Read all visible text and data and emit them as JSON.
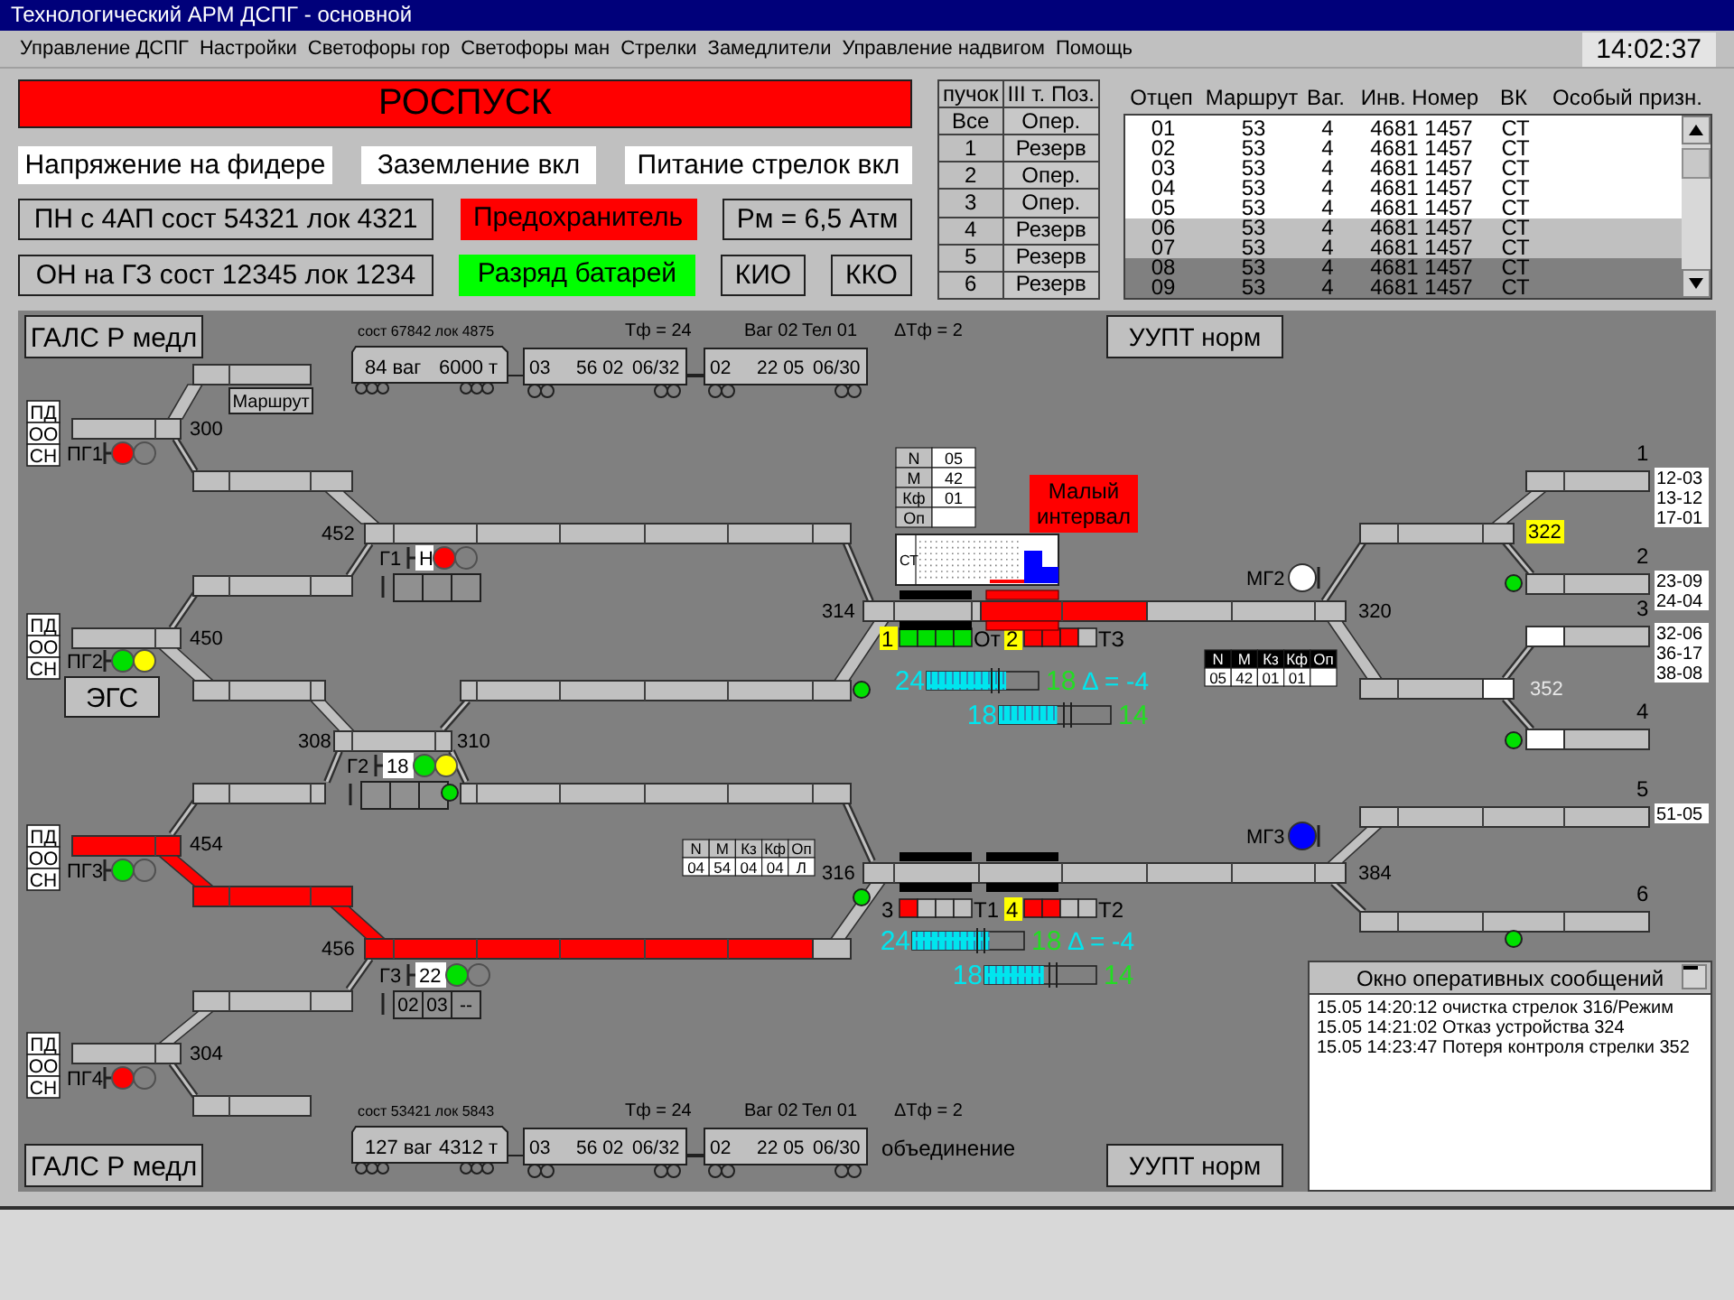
{
  "window": {
    "title": "Технологический АРМ ДСПГ - основной",
    "clock": "14:02:37"
  },
  "menu": [
    "Управление ДСПГ",
    "Настройки",
    "Светофоры гор",
    "Светофоры ман",
    "Стрелки",
    "Замедлители",
    "Управление надвигом",
    "Помощь"
  ],
  "mode_banner": {
    "text": "РОСПУСК",
    "alarm": true
  },
  "status_rows": [
    [
      {
        "text": "Напряжение на фидере",
        "kind": "info"
      },
      {
        "text": "Заземление вкл",
        "kind": "info"
      },
      {
        "text": "Питание стрелок вкл",
        "kind": "info"
      }
    ],
    [
      {
        "text": "ПН с 4АП сост 54321 лок 4321",
        "kind": "button"
      },
      {
        "text": "Предохранитель",
        "kind": "alarm"
      },
      {
        "text": "Рм = 6,5 Атм",
        "kind": "button"
      }
    ],
    [
      {
        "text": "ОН на ГЗ сост 12345 лок 1234",
        "kind": "button"
      },
      {
        "text": "Разряд батарей",
        "kind": "ok"
      },
      {
        "text": "КИО",
        "kind": "button"
      },
      {
        "text": "ККО",
        "kind": "button"
      }
    ]
  ],
  "bundles": {
    "columns": [
      "пучок",
      "III т. Поз."
    ],
    "rows": [
      {
        "bundle": "Все",
        "mode": "Опер."
      },
      {
        "bundle": "1",
        "mode": "Резерв"
      },
      {
        "bundle": "2",
        "mode": "Опер."
      },
      {
        "bundle": "3",
        "mode": "Опер."
      },
      {
        "bundle": "4",
        "mode": "Резерв"
      },
      {
        "bundle": "5",
        "mode": "Резерв"
      },
      {
        "bundle": "6",
        "mode": "Резерв"
      }
    ]
  },
  "cuts": {
    "columns": [
      "Отцеп",
      "Маршрут",
      "Ваг.",
      "Инв. Номер",
      "ВК",
      "Особый призн."
    ],
    "rows": [
      {
        "cut": "01",
        "route": "53",
        "wagons": "4",
        "number": "4681 1457",
        "vk": "СТ",
        "marked": false,
        "selected": false
      },
      {
        "cut": "02",
        "route": "53",
        "wagons": "4",
        "number": "4681 1457",
        "vk": "СТ",
        "marked": false,
        "selected": false
      },
      {
        "cut": "03",
        "route": "53",
        "wagons": "4",
        "number": "4681 1457",
        "vk": "СТ",
        "marked": false,
        "selected": false
      },
      {
        "cut": "04",
        "route": "53",
        "wagons": "4",
        "number": "4681 1457",
        "vk": "СТ",
        "marked": false,
        "selected": false
      },
      {
        "cut": "05",
        "route": "53",
        "wagons": "4",
        "number": "4681 1457",
        "vk": "СТ",
        "marked": false,
        "selected": false
      },
      {
        "cut": "06",
        "route": "53",
        "wagons": "4",
        "number": "4681 1457",
        "vk": "СТ",
        "marked": true,
        "selected": false
      },
      {
        "cut": "07",
        "route": "53",
        "wagons": "4",
        "number": "4681 1457",
        "vk": "СТ",
        "marked": true,
        "selected": false
      },
      {
        "cut": "08",
        "route": "53",
        "wagons": "4",
        "number": "4681 1457",
        "vk": "СТ",
        "marked": false,
        "selected": true
      },
      {
        "cut": "09",
        "route": "53",
        "wagons": "4",
        "number": "4681 1457",
        "vk": "СТ",
        "marked": false,
        "selected": true
      }
    ]
  },
  "diagram": {
    "buttons": [
      "ГАЛС Р медл",
      "УУПТ норм",
      "ЭГС",
      "Маршрут",
      "ГАЛС Р медл",
      "УУПТ норм"
    ],
    "control_stacks": [
      [
        "ПД",
        "ОО",
        "СН"
      ],
      [
        "ПД",
        "ОО",
        "СН"
      ],
      [
        "ПД",
        "ОО",
        "СН"
      ],
      [
        "ПД",
        "ОО",
        "СН"
      ]
    ],
    "trains": [
      {
        "caption": "сост 67842 лок 4875",
        "loco": [
          "84 ваг",
          "6000 т"
        ],
        "tf": "Тф = 24",
        "wagon_info": [
          "Ваг 02",
          "Тел 01"
        ],
        "dtf": "ΔТф = 2",
        "wagons": [
          [
            "03",
            "56 02",
            "06/32"
          ],
          [
            "02",
            "22 05",
            "06/30"
          ]
        ]
      },
      {
        "caption": "сост 53421 лок 5843",
        "loco": [
          "127 ваг",
          "4312 т"
        ],
        "tf": "Тф = 24",
        "wagon_info": [
          "Ваг 02",
          "Тел 01"
        ],
        "dtf": "ΔТф = 2",
        "wagons": [
          [
            "03",
            "56 02",
            "06/32"
          ],
          [
            "02",
            "22 05",
            "06/30"
          ]
        ],
        "note": "объединение"
      }
    ],
    "track_sections": [
      {
        "occupied": false,
        "route_set": false
      },
      {
        "occupied": false,
        "route_set": false
      },
      {
        "occupied": false,
        "route_set": false
      },
      {
        "occupied": false,
        "route_set": false
      },
      {
        "occupied": false,
        "route_set": false
      },
      {
        "occupied": false,
        "route_set": false
      },
      {
        "occupied": false,
        "route_set": false
      },
      {
        "occupied": false,
        "route_set": false
      },
      {
        "occupied": false,
        "route_set": false
      },
      {
        "occupied": false,
        "route_set": false
      },
      {
        "occupied": false,
        "route_set": false
      },
      {
        "occupied": true,
        "route_set": false
      },
      {
        "occupied": true,
        "route_set": false
      },
      {
        "occupied": true,
        "route_set": false
      },
      {
        "occupied": false,
        "route_set": false
      },
      {
        "occupied": false,
        "route_set": false
      },
      {
        "occupied": false,
        "route_set": false
      },
      {
        "occupied": false,
        "route_set": false
      },
      {
        "occupied": false,
        "route_set": false
      },
      {
        "occupied": true,
        "route_set": false
      },
      {
        "occupied": false,
        "route_set": false
      },
      {
        "occupied": false,
        "route_set": false
      },
      {
        "occupied": false,
        "route_set": false
      },
      {
        "occupied": false,
        "route_set": false
      },
      {
        "occupied": false,
        "route_set": false
      },
      {
        "occupied": false,
        "route_set": true
      },
      {
        "occupied": false,
        "route_set": false
      },
      {
        "occupied": false,
        "route_set": false
      },
      {
        "occupied": false,
        "route_set": true
      },
      {
        "occupied": false,
        "route_set": true
      },
      {
        "occupied": false,
        "route_set": false
      },
      {
        "occupied": false,
        "route_set": false
      },
      {
        "occupied": false,
        "route_set": false
      }
    ],
    "switch_labels": [
      {
        "label": "300",
        "warning": false,
        "lost_control": false
      },
      {
        "label": "452",
        "warning": false,
        "lost_control": false
      },
      {
        "label": "450",
        "warning": false,
        "lost_control": false
      },
      {
        "label": "308",
        "warning": false,
        "lost_control": false
      },
      {
        "label": "310",
        "warning": false,
        "lost_control": false
      },
      {
        "label": "454",
        "warning": false,
        "lost_control": false
      },
      {
        "label": "456",
        "warning": false,
        "lost_control": false
      },
      {
        "label": "304",
        "warning": false,
        "lost_control": false
      },
      {
        "label": "314",
        "warning": false,
        "lost_control": false
      },
      {
        "label": "316",
        "warning": false,
        "lost_control": false
      },
      {
        "label": "320",
        "warning": false,
        "lost_control": false
      },
      {
        "label": "322",
        "warning": true,
        "lost_control": false
      },
      {
        "label": "352",
        "warning": false,
        "lost_control": true
      },
      {
        "label": "384",
        "warning": false,
        "lost_control": false
      }
    ],
    "signals": [
      {
        "label": "ПГ1",
        "kind": "hump",
        "lamps": [
          {
            "lit": true,
            "color": "#ff0000"
          },
          {
            "lit": false
          }
        ]
      },
      {
        "label": "Г1",
        "kind": "group",
        "indicator": "Н",
        "lamps": [
          {
            "lit": true,
            "color": "#ff0000"
          },
          {
            "lit": false
          }
        ]
      },
      {
        "label": "ПГ2",
        "kind": "hump",
        "lamps": [
          {
            "lit": true,
            "color": "#00e000"
          },
          {
            "lit": true,
            "color": "#ffff00"
          }
        ]
      },
      {
        "label": "Г2",
        "kind": "group",
        "indicator": "18",
        "lamps": [
          {
            "lit": true,
            "color": "#00e000"
          },
          {
            "lit": true,
            "color": "#ffff00"
          }
        ]
      },
      {
        "label": "ПГ3",
        "kind": "hump",
        "lamps": [
          {
            "lit": true,
            "color": "#00e000"
          },
          {
            "lit": false
          }
        ]
      },
      {
        "label": "Г3",
        "kind": "group",
        "indicator": "22",
        "lamps": [
          {
            "lit": true,
            "color": "#00e000"
          },
          {
            "lit": false
          }
        ],
        "cells": [
          "02",
          "03",
          "--"
        ]
      },
      {
        "label": "ПГ4",
        "kind": "hump",
        "lamps": [
          {
            "lit": true,
            "color": "#ff0000"
          },
          {
            "lit": false
          }
        ]
      },
      {
        "label": "МГ2",
        "kind": "shunt",
        "lamps": [
          {
            "lit": true,
            "color": "#ffffff"
          }
        ]
      },
      {
        "label": "МГ3",
        "kind": "shunt",
        "lamps": [
          {
            "lit": true,
            "color": "#0000ff"
          }
        ]
      }
    ],
    "free_indicators": [
      {
        "lit": true
      },
      {
        "lit": true
      },
      {
        "lit": true
      },
      {
        "lit": true
      },
      {
        "lit": true
      },
      {
        "lit": true
      }
    ],
    "cut_cards": [
      {
        "kind": "vertical",
        "fields": [
          {
            "name": "N",
            "value": "05"
          },
          {
            "name": "М",
            "value": "42"
          },
          {
            "name": "Кф",
            "value": "01"
          },
          {
            "name": "Оп"
          }
        ]
      },
      {
        "kind": "dark",
        "fields": [
          {
            "name": "N",
            "value": "05"
          },
          {
            "name": "М",
            "value": "42"
          },
          {
            "name": "Кз",
            "value": "01"
          },
          {
            "name": "Кф",
            "value": "01"
          },
          {
            "name": "Оп"
          }
        ]
      },
      {
        "kind": "light",
        "fields": [
          {
            "name": "N",
            "value": "04"
          },
          {
            "name": "М",
            "value": "54"
          },
          {
            "name": "Кз",
            "value": "04"
          },
          {
            "name": "Кф",
            "value": "04"
          },
          {
            "name": "Оп",
            "value": "Л"
          }
        ]
      }
    ],
    "alarm_box": {
      "text": "Малый интервал"
    },
    "profile": {
      "label": "СТ"
    },
    "retarders": [
      {
        "number": "1",
        "highlight": true,
        "label": "От",
        "braking": false,
        "cells": [
          {
            "lit": true,
            "color": "#00e000"
          },
          {
            "lit": true,
            "color": "#00e000"
          },
          {
            "lit": true,
            "color": "#00e000"
          },
          {
            "lit": true,
            "color": "#00e000"
          }
        ]
      },
      {
        "number": "2",
        "highlight": true,
        "label": "ТЗ",
        "braking": true,
        "cells": [
          {
            "lit": true,
            "color": "#ff0000"
          },
          {
            "lit": true,
            "color": "#ff0000"
          },
          {
            "lit": true,
            "color": "#ff0000"
          },
          {
            "lit": false
          }
        ]
      },
      {
        "number": "3",
        "highlight": false,
        "label": "Т1",
        "braking": false,
        "cells": [
          {
            "lit": true,
            "color": "#ff0000"
          },
          {
            "lit": false
          },
          {
            "lit": false
          },
          {
            "lit": false
          }
        ]
      },
      {
        "number": "4",
        "highlight": true,
        "label": "Т2",
        "braking": false,
        "cells": [
          {
            "lit": true,
            "color": "#ff0000"
          },
          {
            "lit": true,
            "color": "#ff0000"
          },
          {
            "lit": false
          },
          {
            "lit": false
          }
        ]
      }
    ],
    "speed_bars": [
      {
        "set": "24",
        "level": 0.71,
        "actual": "18",
        "delta": "Δ = -4"
      },
      {
        "set": "18",
        "level": 0.52,
        "actual": "14"
      },
      {
        "set": "24",
        "level": 0.69,
        "actual": "18",
        "delta": "Δ = -4"
      },
      {
        "set": "18",
        "level": 0.53,
        "actual": "14"
      }
    ],
    "hump_tracks": [
      {
        "number": "1",
        "destinations": [
          "12-03",
          "13-12",
          "17-01"
        ]
      },
      {
        "number": "2",
        "destinations": [
          "23-09",
          "24-04"
        ]
      },
      {
        "number": "3",
        "destinations": [
          "32-06",
          "36-17",
          "38-08"
        ]
      },
      {
        "number": "4"
      },
      {
        "number": "5",
        "destinations": [
          "51-05"
        ]
      },
      {
        "number": "6"
      }
    ],
    "messages": {
      "title": "Окно оперативных сообщений",
      "items": [
        "15.05 14:20:12 очистка стрелок 316/Режим",
        "15.05 14:21:02 Отказ устройства 324",
        "15.05 14:23:47 Потеря контроля стрелки 352"
      ]
    }
  }
}
